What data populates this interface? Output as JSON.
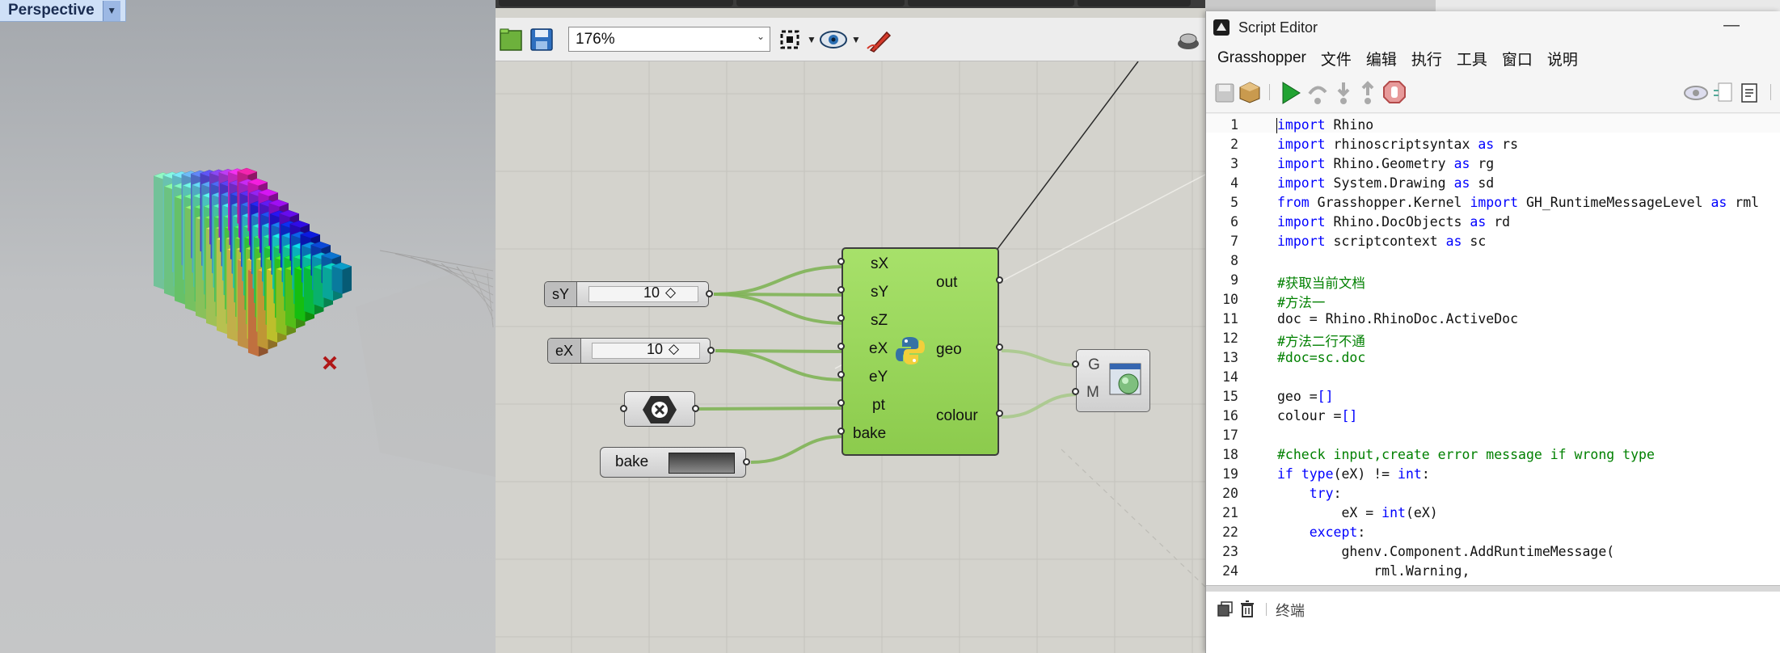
{
  "viewport": {
    "title": "Perspective",
    "dropdown_icon": "triangle-down-icon"
  },
  "canvas": {
    "zoom": "176%",
    "sliders": [
      {
        "label": "sY",
        "value": "10"
      },
      {
        "label": "eX",
        "value": "10"
      }
    ],
    "toggle": {
      "label": "bake"
    },
    "python_component": {
      "inputs": [
        "sX",
        "sY",
        "sZ",
        "eX",
        "eY",
        "pt",
        "bake"
      ],
      "outputs": [
        "out",
        "geo",
        "colour"
      ]
    },
    "panel": {
      "inputs": [
        "G",
        "M"
      ]
    }
  },
  "editor": {
    "title": "Script Editor",
    "menu": [
      "Grasshopper",
      "文件",
      "编辑",
      "执行",
      "工具",
      "窗口",
      "说明"
    ],
    "terminal_label": "终端",
    "code_lines": [
      {
        "n": "1",
        "parts": [
          {
            "k": "kw",
            "t": "import"
          },
          {
            "k": "",
            "t": " Rhino"
          }
        ]
      },
      {
        "n": "2",
        "parts": [
          {
            "k": "kw",
            "t": "import"
          },
          {
            "k": "",
            "t": " rhinoscriptsyntax "
          },
          {
            "k": "kw",
            "t": "as"
          },
          {
            "k": "",
            "t": " rs"
          }
        ]
      },
      {
        "n": "3",
        "parts": [
          {
            "k": "kw",
            "t": "import"
          },
          {
            "k": "",
            "t": " Rhino.Geometry "
          },
          {
            "k": "kw",
            "t": "as"
          },
          {
            "k": "",
            "t": " rg"
          }
        ]
      },
      {
        "n": "4",
        "parts": [
          {
            "k": "kw",
            "t": "import"
          },
          {
            "k": "",
            "t": " System.Drawing "
          },
          {
            "k": "kw",
            "t": "as"
          },
          {
            "k": "",
            "t": " sd"
          }
        ]
      },
      {
        "n": "5",
        "parts": [
          {
            "k": "kw",
            "t": "from"
          },
          {
            "k": "",
            "t": " Grasshopper.Kernel "
          },
          {
            "k": "kw",
            "t": "import"
          },
          {
            "k": "",
            "t": " GH_RuntimeMessageLevel "
          },
          {
            "k": "kw",
            "t": "as"
          },
          {
            "k": "",
            "t": " rml"
          }
        ]
      },
      {
        "n": "6",
        "parts": [
          {
            "k": "kw",
            "t": "import"
          },
          {
            "k": "",
            "t": " Rhino.DocObjects "
          },
          {
            "k": "kw",
            "t": "as"
          },
          {
            "k": "",
            "t": " rd"
          }
        ]
      },
      {
        "n": "7",
        "parts": [
          {
            "k": "kw",
            "t": "import"
          },
          {
            "k": "",
            "t": " scriptcontext "
          },
          {
            "k": "kw",
            "t": "as"
          },
          {
            "k": "",
            "t": " sc"
          }
        ]
      },
      {
        "n": "8",
        "parts": []
      },
      {
        "n": "9",
        "parts": [
          {
            "k": "cm",
            "t": "#获取当前文档"
          }
        ]
      },
      {
        "n": "10",
        "parts": [
          {
            "k": "cm",
            "t": "#方法一"
          }
        ]
      },
      {
        "n": "11",
        "parts": [
          {
            "k": "",
            "t": "doc = Rhino.RhinoDoc.ActiveDoc"
          }
        ]
      },
      {
        "n": "12",
        "parts": [
          {
            "k": "cm",
            "t": "#方法二行不通"
          }
        ]
      },
      {
        "n": "13",
        "parts": [
          {
            "k": "cm",
            "t": "#doc=sc.doc"
          }
        ]
      },
      {
        "n": "14",
        "parts": []
      },
      {
        "n": "15",
        "parts": [
          {
            "k": "",
            "t": "geo ="
          },
          {
            "k": "kw",
            "t": "[]"
          }
        ]
      },
      {
        "n": "16",
        "parts": [
          {
            "k": "",
            "t": "colour ="
          },
          {
            "k": "kw",
            "t": "[]"
          }
        ]
      },
      {
        "n": "17",
        "parts": []
      },
      {
        "n": "18",
        "parts": [
          {
            "k": "cm",
            "t": "#check input,create error message if wrong type"
          }
        ]
      },
      {
        "n": "19",
        "parts": [
          {
            "k": "kw",
            "t": "if"
          },
          {
            "k": "",
            "t": " "
          },
          {
            "k": "kw",
            "t": "type"
          },
          {
            "k": "",
            "t": "(eX) != "
          },
          {
            "k": "kw",
            "t": "int"
          },
          {
            "k": "",
            "t": ":"
          }
        ]
      },
      {
        "n": "20",
        "parts": [
          {
            "k": "",
            "t": "    "
          },
          {
            "k": "kw",
            "t": "try"
          },
          {
            "k": "",
            "t": ":"
          }
        ]
      },
      {
        "n": "21",
        "parts": [
          {
            "k": "",
            "t": "        eX = "
          },
          {
            "k": "kw",
            "t": "int"
          },
          {
            "k": "",
            "t": "(eX)"
          }
        ]
      },
      {
        "n": "22",
        "parts": [
          {
            "k": "",
            "t": "    "
          },
          {
            "k": "kw",
            "t": "except"
          },
          {
            "k": "",
            "t": ":"
          }
        ]
      },
      {
        "n": "23",
        "parts": [
          {
            "k": "",
            "t": "        ghenv.Component.AddRuntimeMessage("
          }
        ]
      },
      {
        "n": "24",
        "parts": [
          {
            "k": "",
            "t": "            rml.Warning,"
          }
        ]
      }
    ]
  }
}
